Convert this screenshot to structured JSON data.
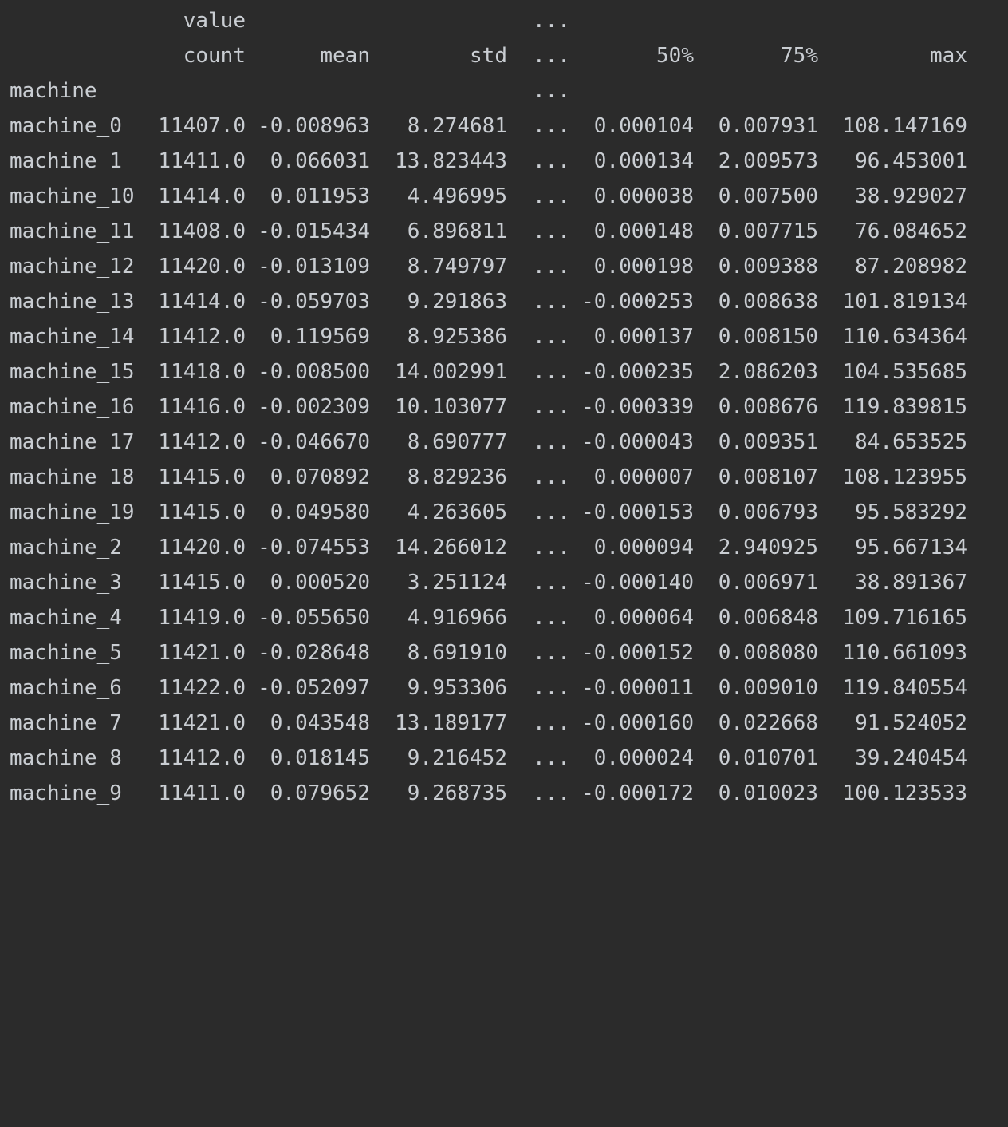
{
  "header": {
    "level0": {
      "value": "value",
      "ellipsis": "..."
    },
    "level1": {
      "count": "count",
      "mean": "mean",
      "std": "std",
      "ellipsis": "...",
      "p50": "50%",
      "p75": "75%",
      "max": "max"
    },
    "index_name": {
      "label": "machine",
      "ellipsis": "..."
    }
  },
  "rows": [
    {
      "idx": "machine_0",
      "count": "11407.0",
      "mean": "-0.008963",
      "std": "8.274681",
      "ell": "...",
      "p50": "0.000104",
      "p75": "0.007931",
      "max": "108.147169"
    },
    {
      "idx": "machine_1",
      "count": "11411.0",
      "mean": "0.066031",
      "std": "13.823443",
      "ell": "...",
      "p50": "0.000134",
      "p75": "2.009573",
      "max": "96.453001"
    },
    {
      "idx": "machine_10",
      "count": "11414.0",
      "mean": "0.011953",
      "std": "4.496995",
      "ell": "...",
      "p50": "0.000038",
      "p75": "0.007500",
      "max": "38.929027"
    },
    {
      "idx": "machine_11",
      "count": "11408.0",
      "mean": "-0.015434",
      "std": "6.896811",
      "ell": "...",
      "p50": "0.000148",
      "p75": "0.007715",
      "max": "76.084652"
    },
    {
      "idx": "machine_12",
      "count": "11420.0",
      "mean": "-0.013109",
      "std": "8.749797",
      "ell": "...",
      "p50": "0.000198",
      "p75": "0.009388",
      "max": "87.208982"
    },
    {
      "idx": "machine_13",
      "count": "11414.0",
      "mean": "-0.059703",
      "std": "9.291863",
      "ell": "...",
      "p50": "-0.000253",
      "p75": "0.008638",
      "max": "101.819134"
    },
    {
      "idx": "machine_14",
      "count": "11412.0",
      "mean": "0.119569",
      "std": "8.925386",
      "ell": "...",
      "p50": "0.000137",
      "p75": "0.008150",
      "max": "110.634364"
    },
    {
      "idx": "machine_15",
      "count": "11418.0",
      "mean": "-0.008500",
      "std": "14.002991",
      "ell": "...",
      "p50": "-0.000235",
      "p75": "2.086203",
      "max": "104.535685"
    },
    {
      "idx": "machine_16",
      "count": "11416.0",
      "mean": "-0.002309",
      "std": "10.103077",
      "ell": "...",
      "p50": "-0.000339",
      "p75": "0.008676",
      "max": "119.839815"
    },
    {
      "idx": "machine_17",
      "count": "11412.0",
      "mean": "-0.046670",
      "std": "8.690777",
      "ell": "...",
      "p50": "-0.000043",
      "p75": "0.009351",
      "max": "84.653525"
    },
    {
      "idx": "machine_18",
      "count": "11415.0",
      "mean": "0.070892",
      "std": "8.829236",
      "ell": "...",
      "p50": "0.000007",
      "p75": "0.008107",
      "max": "108.123955"
    },
    {
      "idx": "machine_19",
      "count": "11415.0",
      "mean": "0.049580",
      "std": "4.263605",
      "ell": "...",
      "p50": "-0.000153",
      "p75": "0.006793",
      "max": "95.583292"
    },
    {
      "idx": "machine_2",
      "count": "11420.0",
      "mean": "-0.074553",
      "std": "14.266012",
      "ell": "...",
      "p50": "0.000094",
      "p75": "2.940925",
      "max": "95.667134"
    },
    {
      "idx": "machine_3",
      "count": "11415.0",
      "mean": "0.000520",
      "std": "3.251124",
      "ell": "...",
      "p50": "-0.000140",
      "p75": "0.006971",
      "max": "38.891367"
    },
    {
      "idx": "machine_4",
      "count": "11419.0",
      "mean": "-0.055650",
      "std": "4.916966",
      "ell": "...",
      "p50": "0.000064",
      "p75": "0.006848",
      "max": "109.716165"
    },
    {
      "idx": "machine_5",
      "count": "11421.0",
      "mean": "-0.028648",
      "std": "8.691910",
      "ell": "...",
      "p50": "-0.000152",
      "p75": "0.008080",
      "max": "110.661093"
    },
    {
      "idx": "machine_6",
      "count": "11422.0",
      "mean": "-0.052097",
      "std": "9.953306",
      "ell": "...",
      "p50": "-0.000011",
      "p75": "0.009010",
      "max": "119.840554"
    },
    {
      "idx": "machine_7",
      "count": "11421.0",
      "mean": "0.043548",
      "std": "13.189177",
      "ell": "...",
      "p50": "-0.000160",
      "p75": "0.022668",
      "max": "91.524052"
    },
    {
      "idx": "machine_8",
      "count": "11412.0",
      "mean": "0.018145",
      "std": "9.216452",
      "ell": "...",
      "p50": "0.000024",
      "p75": "0.010701",
      "max": "39.240454"
    },
    {
      "idx": "machine_9",
      "count": "11411.0",
      "mean": "0.079652",
      "std": "9.268735",
      "ell": "...",
      "p50": "-0.000172",
      "p75": "0.010023",
      "max": "100.123533"
    }
  ]
}
